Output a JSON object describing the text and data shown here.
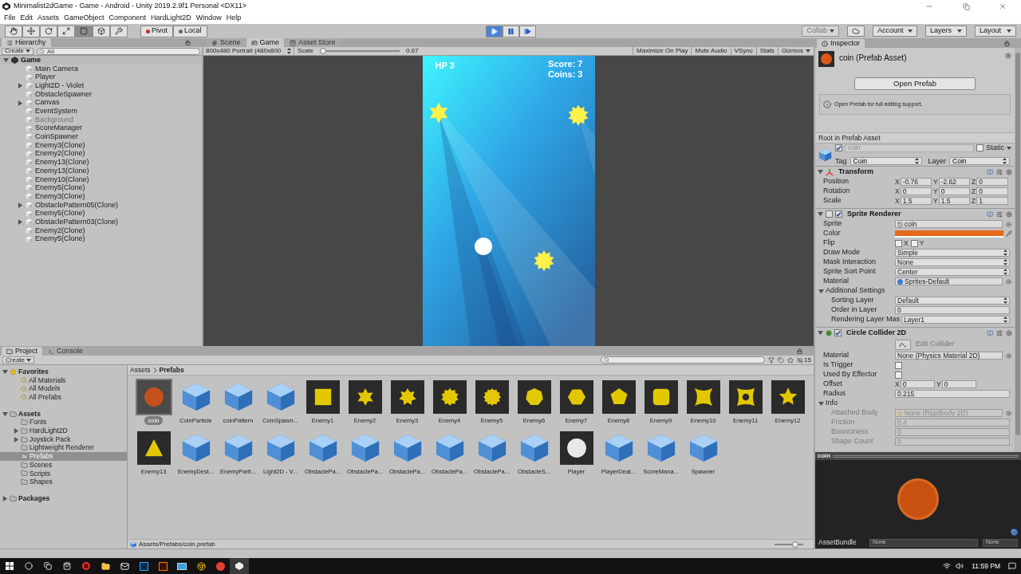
{
  "window": {
    "title": "Minimalist2dGame - Game - Android - Unity 2019.2.9f1 Personal <DX11>"
  },
  "menu": [
    "File",
    "Edit",
    "Assets",
    "GameObject",
    "Component",
    "HardLight2D",
    "Window",
    "Help"
  ],
  "toolbar": {
    "tools": [
      {
        "kind": "hand",
        "selected": false
      },
      {
        "kind": "move",
        "selected": false
      },
      {
        "kind": "rotate",
        "selected": false
      },
      {
        "kind": "scale",
        "selected": false
      },
      {
        "kind": "rect",
        "selected": true
      },
      {
        "kind": "transform",
        "selected": false
      },
      {
        "kind": "custom",
        "selected": false
      }
    ],
    "pivot": "Pivot",
    "local": "Local",
    "playback": [
      {
        "kind": "play",
        "selected": true
      },
      {
        "kind": "pause",
        "selected": false
      },
      {
        "kind": "step",
        "selected": false
      }
    ],
    "collab": "Collab",
    "account": "Account",
    "layers": "Layers",
    "layout": "Layout"
  },
  "hierarchy": {
    "tab": "Hierarchy",
    "create": "Create",
    "search_placeholder": "All",
    "root": {
      "label": "Game",
      "expanded": true
    },
    "items": [
      {
        "label": "Main Camera",
        "active": true
      },
      {
        "label": "Player",
        "active": true
      },
      {
        "label": "Light2D - Violet",
        "active": true,
        "expanded": false
      },
      {
        "label": "ObstacleSpawner",
        "active": true
      },
      {
        "label": "Canvas",
        "active": true,
        "expanded": false
      },
      {
        "label": "EventSystem",
        "active": true
      },
      {
        "label": "Background",
        "active": false
      },
      {
        "label": "ScoreManager",
        "active": true
      },
      {
        "label": "CoinSpawner",
        "active": true
      },
      {
        "label": "Enemy3(Clone)",
        "active": true
      },
      {
        "label": "Enemy2(Clone)",
        "active": true
      },
      {
        "label": "Enemy13(Clone)",
        "active": true
      },
      {
        "label": "Enemy13(Clone)",
        "active": true
      },
      {
        "label": "Enemy10(Clone)",
        "active": true
      },
      {
        "label": "Enemy5(Clone)",
        "active": true
      },
      {
        "label": "Enemy3(Clone)",
        "active": true
      },
      {
        "label": "ObstaclePattern05(Clone)",
        "active": true,
        "expanded": false
      },
      {
        "label": "Enemy5(Clone)",
        "active": true
      },
      {
        "label": "ObstaclePattern03(Clone)",
        "active": true,
        "expanded": false
      },
      {
        "label": "Enemy2(Clone)",
        "active": true
      },
      {
        "label": "Enemy5(Clone)",
        "active": true
      }
    ]
  },
  "game": {
    "tabs": [
      {
        "label": "Scene",
        "kind": "scene",
        "selected": false
      },
      {
        "label": "Game",
        "kind": "game",
        "selected": true
      },
      {
        "label": "Asset Store",
        "kind": "store",
        "selected": false
      }
    ],
    "resolution": "800x480 Portrait (480x800",
    "scale_label": "Scale",
    "scale": {
      "level": 0.02
    },
    "scale_value": "0.67",
    "toggles": [
      {
        "label": "Maximize On Play",
        "kind": "toggle"
      },
      {
        "label": "Mute Audio",
        "kind": "toggle"
      },
      {
        "label": "VSync",
        "kind": "toggle"
      },
      {
        "label": "Stats",
        "kind": "toggle"
      },
      {
        "label": "Gizmos",
        "kind": "dropdown"
      }
    ],
    "hud": {
      "hp": "HP 3",
      "score": "Score: 7",
      "coins": "Coins: 3"
    }
  },
  "inspector": {
    "tab": "Inspector",
    "title": "coin (Prefab Asset)",
    "open_button": "Open Prefab",
    "info": "Open Prefab for full editing support.",
    "root_label": "Root in Prefab Asset",
    "object": {
      "active": true,
      "name": "coin",
      "static_label": "Static",
      "static": false,
      "tag_label": "Tag",
      "tag": "Coin",
      "layer_label": "Layer",
      "layer": "Coin"
    },
    "components": [
      {
        "kind": "transform",
        "title": "Transform",
        "expanded": true,
        "props": [
          {
            "kind": "vector",
            "label": "Position",
            "axes": [
              {
                "axis": "X",
                "value": "-0.76"
              },
              {
                "axis": "Y",
                "value": "-2.62"
              },
              {
                "axis": "Z",
                "value": "0"
              }
            ]
          },
          {
            "kind": "vector",
            "label": "Rotation",
            "axes": [
              {
                "axis": "X",
                "value": "0"
              },
              {
                "axis": "Y",
                "value": "0"
              },
              {
                "axis": "Z",
                "value": "0"
              }
            ]
          },
          {
            "kind": "vector",
            "label": "Scale",
            "axes": [
              {
                "axis": "X",
                "value": "1.5"
              },
              {
                "axis": "Y",
                "value": "1.5"
              },
              {
                "axis": "Z",
                "value": "1"
              }
            ]
          }
        ]
      },
      {
        "kind": "sprite",
        "title": "Sprite Renderer",
        "expanded": true,
        "enabled": true,
        "props": [
          {
            "kind": "sprite-ref",
            "label": "Sprite",
            "value": "coin"
          },
          {
            "kind": "color",
            "label": "Color",
            "color": "#e8691a"
          },
          {
            "kind": "flip",
            "label": "Flip",
            "options": [
              {
                "label": "X",
                "checked": false
              },
              {
                "label": "Y",
                "checked": false
              }
            ]
          },
          {
            "kind": "dropdown",
            "label": "Draw Mode",
            "value": "Simple"
          },
          {
            "kind": "dropdown",
            "label": "Mask Interaction",
            "value": "None"
          },
          {
            "kind": "dropdown",
            "label": "Sprite Sort Point",
            "value": "Center"
          },
          {
            "kind": "material-ref",
            "label": "Material",
            "value": "Sprites-Default"
          },
          {
            "kind": "section",
            "label": "Additional Settings",
            "expanded": true,
            "children": [
              {
                "kind": "dropdown",
                "label": "Sorting Layer",
                "value": "Default"
              },
              {
                "kind": "text",
                "label": "Order in Layer",
                "value": "0"
              },
              {
                "kind": "dropdown",
                "label": "Rendering Layer Mas",
                "value": "Layer1"
              }
            ]
          }
        ]
      },
      {
        "kind": "collider",
        "title": "Circle Collider 2D",
        "expanded": true,
        "enabled": true,
        "props": [
          {
            "kind": "button",
            "label": "Edit Collider"
          },
          {
            "kind": "object",
            "label": "Material",
            "value": "None (Physics Material 2D)"
          },
          {
            "kind": "checkbox",
            "label": "Is Trigger",
            "checked": false
          },
          {
            "kind": "checkbox",
            "label": "Used By Effector",
            "checked": false
          },
          {
            "kind": "vector",
            "label": "Offset",
            "axes": [
              {
                "axis": "X",
                "value": "0"
              },
              {
                "axis": "Y",
                "value": "0"
              }
            ]
          },
          {
            "kind": "text",
            "label": "Radius",
            "value": "0.215"
          },
          {
            "kind": "section",
            "label": "Info",
            "expanded": true,
            "children": [
              {
                "kind": "body-ref",
                "label": "Attached Body",
                "value": "None (Rigidbody 2D)",
                "disabled": true
              },
              {
                "kind": "text",
                "label": "Friction",
                "value": "0.4",
                "disabled": true
              },
              {
                "kind": "text",
                "label": "Bounciness",
                "value": "0",
                "disabled": true
              },
              {
                "kind": "text",
                "label": "Shape Count",
                "value": "0",
                "disabled": true
              }
            ]
          }
        ]
      }
    ]
  },
  "preview": {
    "title": "coin",
    "asset_bundle_label": "AssetBundle",
    "bundle": "None",
    "variant": "None"
  },
  "project": {
    "tabs": [
      {
        "label": "Project",
        "kind": "project",
        "selected": true
      },
      {
        "label": "Console",
        "kind": "console",
        "selected": false
      }
    ],
    "create": "Create",
    "hidden_count": "15",
    "tree": [
      {
        "label": "Favorites",
        "kind": "favorites",
        "selected": false,
        "expanded": true,
        "children": [
          {
            "label": "All Materials",
            "kind": "search",
            "selected": false
          },
          {
            "label": "All Models",
            "kind": "search",
            "selected": false
          },
          {
            "label": "All Prefabs",
            "kind": "search",
            "selected": false
          }
        ]
      },
      {
        "label": "Assets",
        "kind": "folder",
        "selected": false,
        "expanded": true,
        "children": [
          {
            "label": "Fonts",
            "kind": "folder",
            "selected": false
          },
          {
            "label": "HardLight2D",
            "kind": "folder",
            "selected": false,
            "expanded": false
          },
          {
            "label": "Joystick Pack",
            "kind": "folder",
            "selected": false,
            "expanded": false
          },
          {
            "label": "Lightweight Renderer",
            "kind": "folder",
            "selected": false
          },
          {
            "label": "Prefabs",
            "kind": "folder",
            "selected": true
          },
          {
            "label": "Scenes",
            "kind": "folder",
            "selected": false
          },
          {
            "label": "Scripts",
            "kind": "folder",
            "selected": false
          },
          {
            "label": "Shapes",
            "kind": "folder",
            "selected": false
          }
        ]
      },
      {
        "label": "Packages",
        "kind": "folder",
        "selected": false,
        "expanded": false
      }
    ],
    "breadcrumb": [
      "Assets",
      "Prefabs"
    ],
    "assets": [
      {
        "label": "coin",
        "kind": "circle",
        "color": "#c4501a",
        "selected": true
      },
      {
        "label": "CoinParticle",
        "kind": "prefab",
        "selected": false
      },
      {
        "label": "coinPattern",
        "kind": "prefab",
        "selected": false
      },
      {
        "label": "CoinSpawn...",
        "kind": "prefab",
        "selected": false
      },
      {
        "label": "Enemy1",
        "kind": "square",
        "color": "#e2c800",
        "selected": false
      },
      {
        "label": "Enemy2",
        "kind": "star6",
        "color": "#e2c800",
        "selected": false
      },
      {
        "label": "Enemy3",
        "kind": "star7",
        "color": "#e2c800",
        "selected": false
      },
      {
        "label": "Enemy4",
        "kind": "star10",
        "color": "#e2c800",
        "selected": false
      },
      {
        "label": "Enemy5",
        "kind": "star12",
        "color": "#e2c800",
        "selected": false
      },
      {
        "label": "Enemy6",
        "kind": "heptagon",
        "color": "#e2c800",
        "selected": false
      },
      {
        "label": "Enemy7",
        "kind": "hexagon",
        "color": "#e2c800",
        "selected": false
      },
      {
        "label": "Enemy8",
        "kind": "pentagon",
        "color": "#e2c800",
        "selected": false
      },
      {
        "label": "Enemy9",
        "kind": "rounded-square",
        "color": "#e2c800",
        "selected": false
      },
      {
        "label": "Enemy10",
        "kind": "pinched-square",
        "color": "#e2c800",
        "selected": false
      },
      {
        "label": "Enemy11",
        "kind": "holed-square",
        "color": "#e2c800",
        "selected": false
      },
      {
        "label": "Enemy12",
        "kind": "star5",
        "color": "#e2c800",
        "selected": false
      },
      {
        "label": "Enemy13",
        "kind": "triangle",
        "color": "#e2c800",
        "selected": false
      },
      {
        "label": "EnemyDest...",
        "kind": "prefab",
        "selected": false
      },
      {
        "label": "EnemyParti...",
        "kind": "prefab",
        "selected": false
      },
      {
        "label": "Light2D - V...",
        "kind": "prefab",
        "selected": false
      },
      {
        "label": "ObstaclePa...",
        "kind": "prefab",
        "selected": false
      },
      {
        "label": "ObstaclePa...",
        "kind": "prefab",
        "selected": false
      },
      {
        "label": "ObstaclePa...",
        "kind": "prefab",
        "selected": false
      },
      {
        "label": "ObstaclePa...",
        "kind": "prefab",
        "selected": false
      },
      {
        "label": "ObstaclePa...",
        "kind": "prefab",
        "selected": false
      },
      {
        "label": "ObstacleS...",
        "kind": "prefab",
        "selected": false
      },
      {
        "label": "Player",
        "kind": "circle",
        "color": "#e8e8e8",
        "selected": false
      },
      {
        "label": "PlayerDeat...",
        "kind": "prefab",
        "selected": false
      },
      {
        "label": "ScoreMana...",
        "kind": "prefab",
        "selected": false
      },
      {
        "label": "Spawner",
        "kind": "prefab",
        "selected": false
      }
    ],
    "path": "Assets/Prefabs/coin.prefab",
    "zoom": {
      "level": 0.8
    }
  },
  "taskbar": {
    "time": "11:59 PM"
  }
}
